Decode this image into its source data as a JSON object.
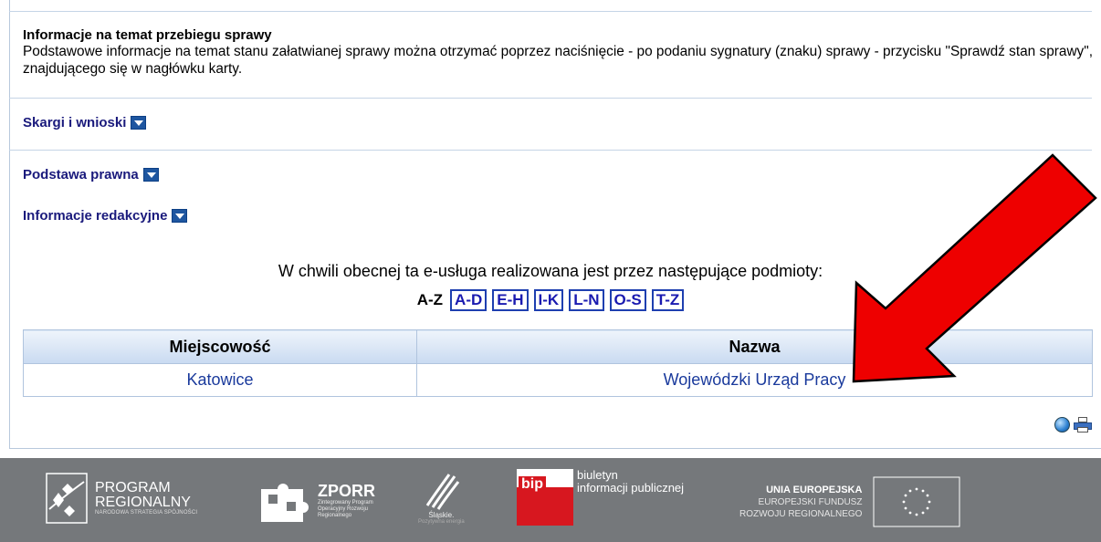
{
  "sections": {
    "info_title": "Informacje na temat przebiegu sprawy",
    "info_text": "Podstawowe informacje na temat stanu załatwianej sprawy można otrzymać poprzez naciśnięcie - po podaniu sygnatury (znaku) sprawy - przycisku \"Sprawdź stan sprawy\", znajdującego się w nagłówku karty.",
    "complaints": "Skargi i wnioski",
    "legal_basis": "Podstawa prawna",
    "editorial": "Informacje redakcyjne"
  },
  "providers": {
    "intro": "W chwili obecnej ta e-usługa realizowana jest przez następujące podmioty:",
    "az_label": "A-Z",
    "az_buttons": [
      "A-D",
      "E-H",
      "I-K",
      "L-N",
      "O-S",
      "T-Z"
    ],
    "table": {
      "headers": [
        "Miejscowość",
        "Nazwa"
      ],
      "rows": [
        [
          "Katowice",
          "Wojewódzki Urząd Pracy"
        ]
      ]
    }
  },
  "footer": {
    "program_line1": "PROGRAM",
    "program_line2": "REGIONALNY",
    "program_line3": "NARODOWA STRATEGIA SPÓJNOŚCI",
    "zporr_title": "ZPORR",
    "zporr_sub": "Zintegrowany Program Operacyjny Rozwoju Regionalnego",
    "slaskie_line1": "Śląskie.",
    "slaskie_line2": "Pozytywna energia",
    "bip_badge": "bip",
    "bip_line1": "biuletyn",
    "bip_line2": "informacji publicznej",
    "eu_line1": "UNIA EUROPEJSKA",
    "eu_line2": "EUROPEJSKI FUNDUSZ",
    "eu_line3": "ROZWOJU REGIONALNEGO"
  },
  "colors": {
    "link": "#1a1a7c",
    "footer_bg": "#75787b",
    "arrow": "#ee0000"
  },
  "icons": [
    "dropdown-arrow-icon",
    "globe-icon",
    "printer-icon",
    "red-arrow-annotation"
  ]
}
